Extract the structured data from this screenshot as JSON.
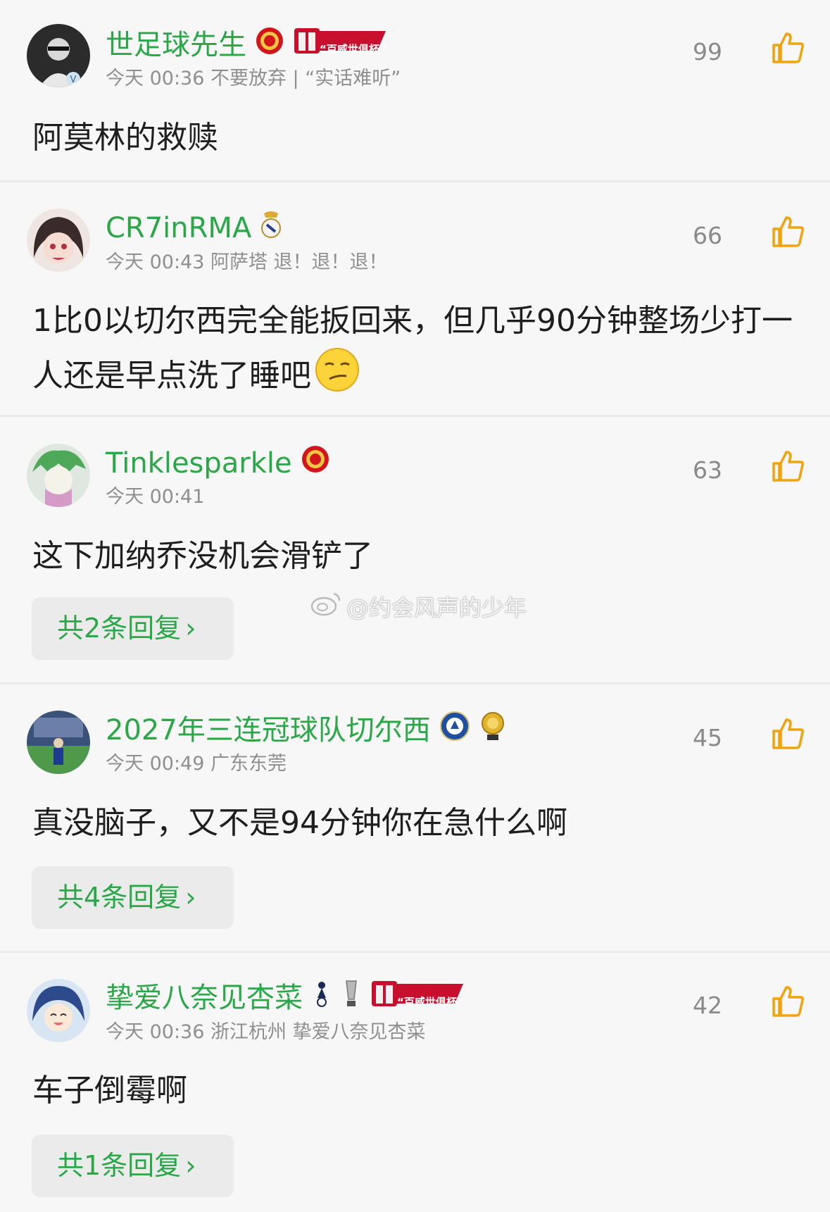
{
  "colors": {
    "username": "#2aa848",
    "meta": "#8f8f8f",
    "text": "#1e1e1e",
    "reply_bg": "#ebebeb"
  },
  "watermark": {
    "text": "@约会风声的少年",
    "icon": "weibo-logo-icon"
  },
  "comments": [
    {
      "username": "世足球先生",
      "badges": [
        "manchester-united-badge-icon",
        "budweiser-club-world-cup-badge-icon"
      ],
      "badge_text": "“百威世俱杯”",
      "meta": "今天 00:36 不要放弃 | “实话难听”",
      "likes": "99",
      "text": "阿莫林的救赎"
    },
    {
      "username": "CR7inRMA",
      "badges": [
        "real-madrid-badge-icon"
      ],
      "meta": "今天 00:43 阿萨塔 退！退！退！",
      "likes": "66",
      "text": "1比0以切尔西完全能扳回来，但几乎90分钟整场少打一人还是早点洗了睡吧",
      "emoji": "smirk-emoji-icon"
    },
    {
      "username": "Tinklesparkle",
      "badges": [
        "manchester-united-badge-icon"
      ],
      "meta": "今天 00:41",
      "likes": "63",
      "text": "这下加纳乔没机会滑铲了",
      "reply": "共2条回复"
    },
    {
      "username": "2027年三连冠球队切尔西",
      "badges": [
        "chelsea-badge-icon",
        "gold-medal-icon"
      ],
      "meta": "今天 00:49 广东东莞",
      "likes": "45",
      "text": "真没脑子，又不是94分钟你在急什么啊",
      "reply": "共4条回复"
    },
    {
      "username": "挚爱八奈见杏菜",
      "badges": [
        "tottenham-badge-icon",
        "europa-league-trophy-icon",
        "budweiser-club-world-cup-badge-icon"
      ],
      "badge_text": "“百威世俱杯”",
      "meta": "今天 00:36 浙江杭州 挚爱八奈见杏菜",
      "likes": "42",
      "text": "车子倒霉啊",
      "reply": "共1条回复"
    }
  ]
}
